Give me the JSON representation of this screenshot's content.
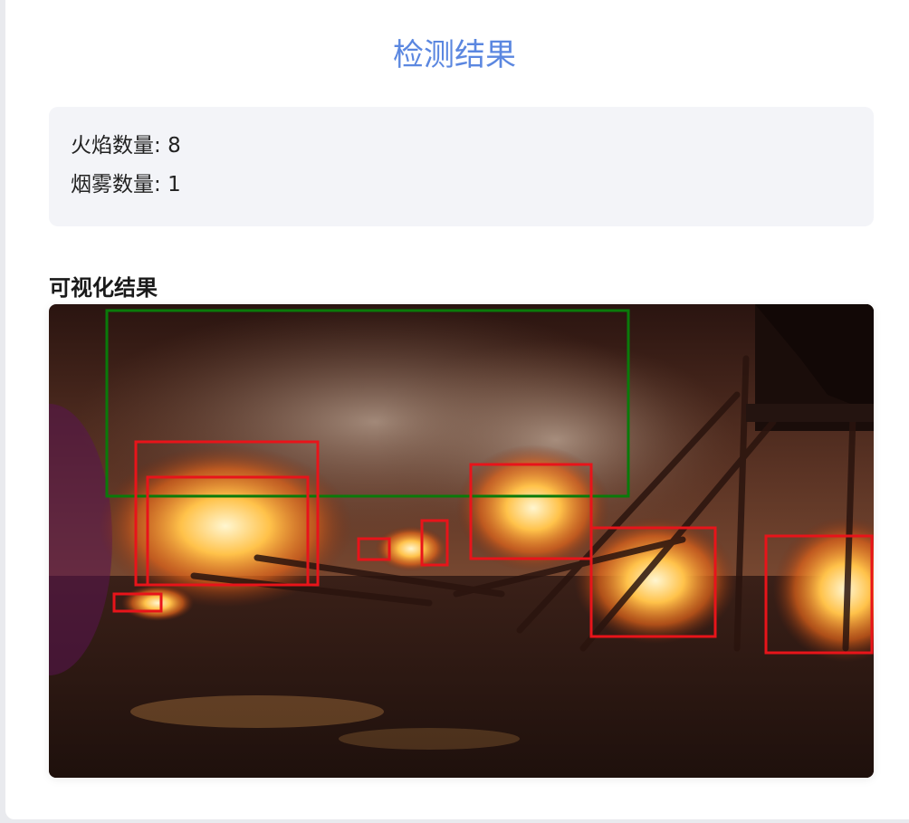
{
  "header": {
    "title": "检测结果"
  },
  "stats": {
    "fire_label": "火焰数量:",
    "fire_count": "8",
    "smoke_label": "烟雾数量:",
    "smoke_count": "1"
  },
  "visualization": {
    "section_title": "可视化结果",
    "image_description": "fire-scene-photo",
    "smoke_box_color": "#0a7a0a",
    "fire_box_color": "#e8141a"
  }
}
